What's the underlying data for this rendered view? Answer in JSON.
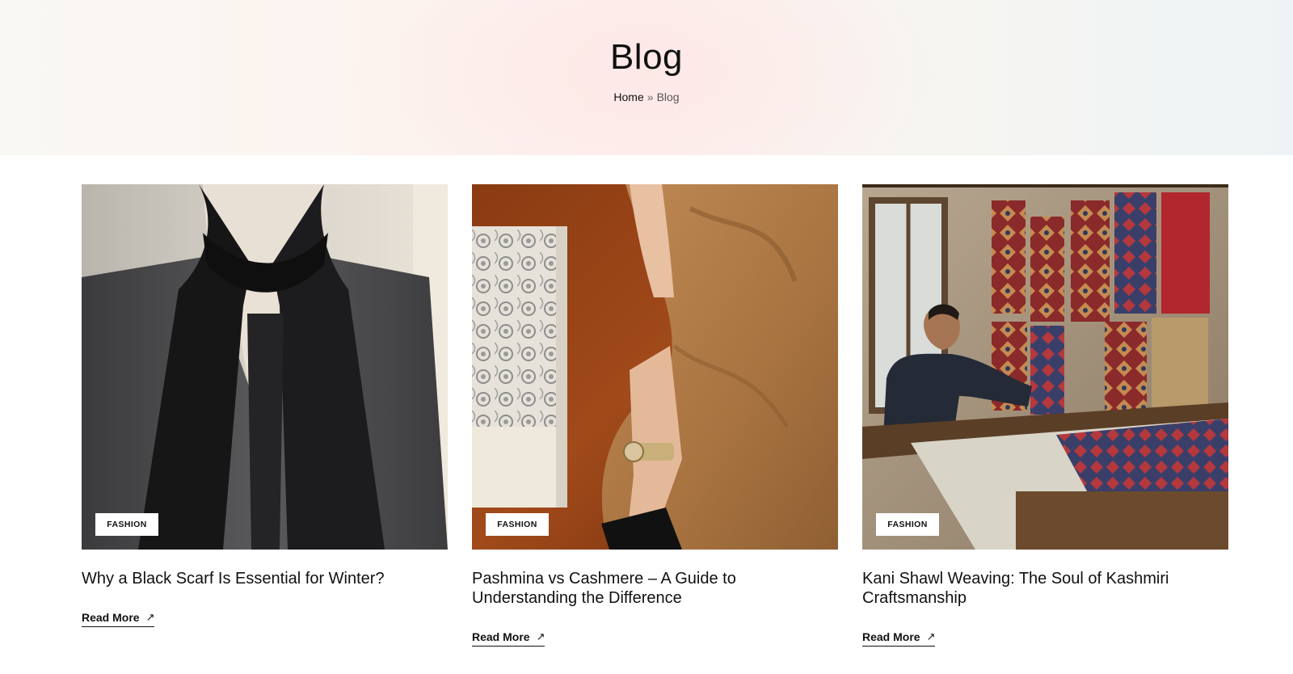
{
  "page": {
    "title": "Blog",
    "breadcrumb": {
      "home": "Home",
      "separator": "»",
      "current": "Blog"
    }
  },
  "posts": [
    {
      "category": "FASHION",
      "title": "Why a Black Scarf Is Essential for Winter?",
      "link_label": "Read More",
      "image_icon": "black-scarf-on-mannequin-photo"
    },
    {
      "category": "FASHION",
      "title": "Pashmina vs Cashmere – A Guide to Understanding the Difference",
      "link_label": "Read More",
      "image_icon": "pashmina-shawls-photo"
    },
    {
      "category": "FASHION",
      "title": "Kani Shawl Weaving: The Soul of Kashmiri Craftsmanship",
      "link_label": "Read More",
      "image_icon": "loom-weaving-photo"
    }
  ],
  "colors": {
    "text": "#111111",
    "tag_bg": "#ffffff",
    "hero_tint": "#fdf0ee"
  }
}
